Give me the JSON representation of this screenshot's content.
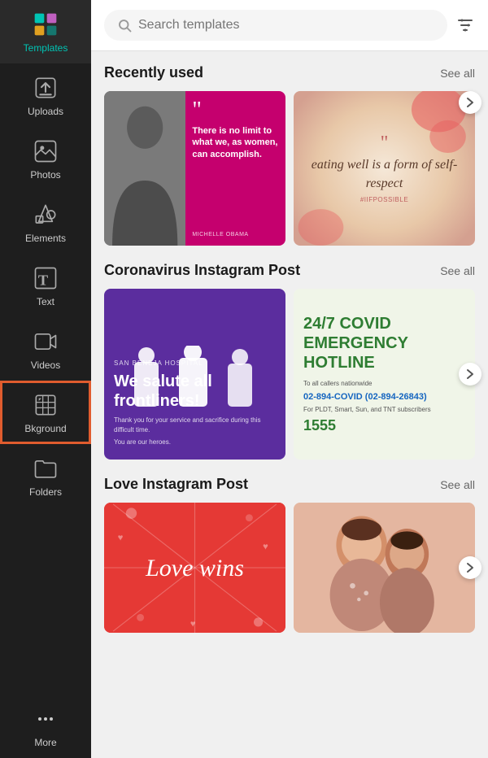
{
  "sidebar": {
    "items": [
      {
        "id": "templates",
        "label": "Templates",
        "active": true
      },
      {
        "id": "uploads",
        "label": "Uploads",
        "active": false
      },
      {
        "id": "photos",
        "label": "Photos",
        "active": false
      },
      {
        "id": "elements",
        "label": "Elements",
        "active": false
      },
      {
        "id": "text",
        "label": "Text",
        "active": false
      },
      {
        "id": "videos",
        "label": "Videos",
        "active": false
      },
      {
        "id": "background",
        "label": "Bkground",
        "active": false,
        "selected": true
      },
      {
        "id": "folders",
        "label": "Folders",
        "active": false
      },
      {
        "id": "more",
        "label": "More",
        "active": false
      }
    ]
  },
  "search": {
    "placeholder": "Search templates"
  },
  "sections": [
    {
      "id": "recently-used",
      "title": "Recently used",
      "see_all_label": "See all"
    },
    {
      "id": "coronavirus",
      "title": "Coronavirus Instagram Post",
      "see_all_label": "See all"
    },
    {
      "id": "love",
      "title": "Love Instagram Post",
      "see_all_label": "See all"
    }
  ],
  "cards": {
    "recently_used": [
      {
        "type": "quote-bw",
        "quote": "There is no limit to what we, as women, can accomplish.",
        "author": "MICHELLE OBAMA"
      },
      {
        "type": "food-quote",
        "quote": "eating well is a form of self-respect"
      }
    ],
    "coronavirus": [
      {
        "type": "covid-frontliners",
        "hospital": "SAN BENEJA HOSPITAL",
        "headline": "We salute all frontliners!",
        "sub1": "Thank you for your service and sacrifice during this difficult time.",
        "sub2": "You are our heroes."
      },
      {
        "type": "covid-hotline",
        "headline": "24/7 COVID EMERGENCY HOTLINE",
        "sub1": "To all callers nationwide",
        "number": "02-894-COVID (02-894-26843)",
        "sub2": "For PLDT, Smart, Sun, and TNT subscribers",
        "number2": "1555"
      }
    ],
    "love": [
      {
        "type": "love-wins",
        "text": "Love wins"
      },
      {
        "type": "love-photo",
        "desc": "Children photo"
      }
    ]
  }
}
